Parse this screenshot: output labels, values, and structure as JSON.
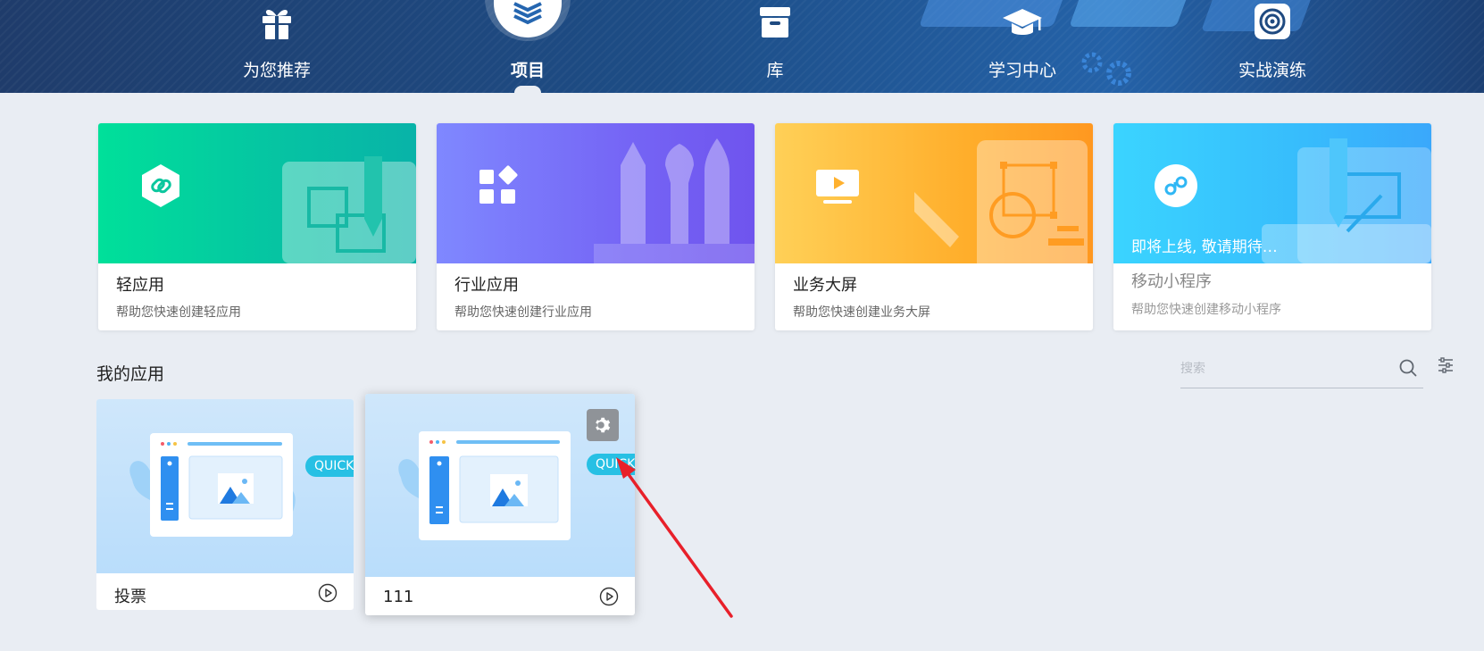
{
  "nav": {
    "items": [
      {
        "label": "为您推荐",
        "icon": "gift-icon"
      },
      {
        "label": "项目",
        "icon": "layers-icon",
        "active": true
      },
      {
        "label": "库",
        "icon": "archive-box-icon"
      },
      {
        "label": "学习中心",
        "icon": "graduation-cap-icon"
      },
      {
        "label": "实战演练",
        "icon": "target-icon"
      }
    ]
  },
  "features": [
    {
      "title": "轻应用",
      "desc": "帮助您快速创建轻应用",
      "icon": "link-hexagon-icon",
      "color_from": "#00e09a",
      "color_to": "#08b5a8"
    },
    {
      "title": "行业应用",
      "desc": "帮助您快速创建行业应用",
      "icon": "apps-grid-icon",
      "color_from": "#7d86ff",
      "color_to": "#7357f0"
    },
    {
      "title": "业务大屏",
      "desc": "帮助您快速创建业务大屏",
      "icon": "screen-play-icon",
      "color_from": "#ffc94a",
      "color_to": "#ff9a1f"
    },
    {
      "title": "移动小程序",
      "desc": "帮助您快速创建移动小程序",
      "icon": "mini-program-icon",
      "color_from": "#3fd2ff",
      "color_to": "#3aa7fb",
      "badge": "即将上线, 敬请期待…"
    }
  ],
  "my_apps": {
    "title": "我的应用",
    "search_placeholder": "搜索",
    "apps": [
      {
        "name": "投票",
        "tag": "QUICK"
      },
      {
        "name": "111",
        "tag": "QUICK"
      }
    ]
  }
}
